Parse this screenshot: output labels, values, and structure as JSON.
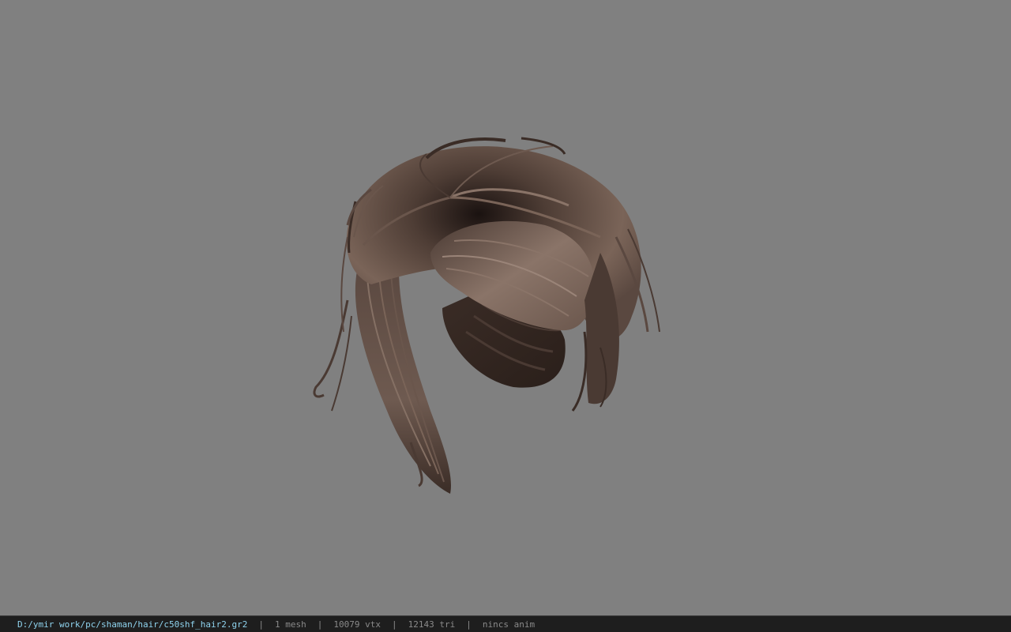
{
  "viewport": {
    "background_color": "#808080",
    "model_name": "hair-mesh",
    "hair_colors": {
      "light": "#8a7468",
      "mid": "#5a4840",
      "dark": "#2a1f1a"
    }
  },
  "statusbar": {
    "file_path": "D:/ymir work/pc/shaman/hair/c50shf_hair2.gr2",
    "separator": "|",
    "mesh_count": "1 mesh",
    "vertex_count": "10079 vtx",
    "triangle_count": "12143 tri",
    "animation": "nincs anim",
    "path_color": "#8fd3ee",
    "text_color": "#8a8a8a"
  }
}
